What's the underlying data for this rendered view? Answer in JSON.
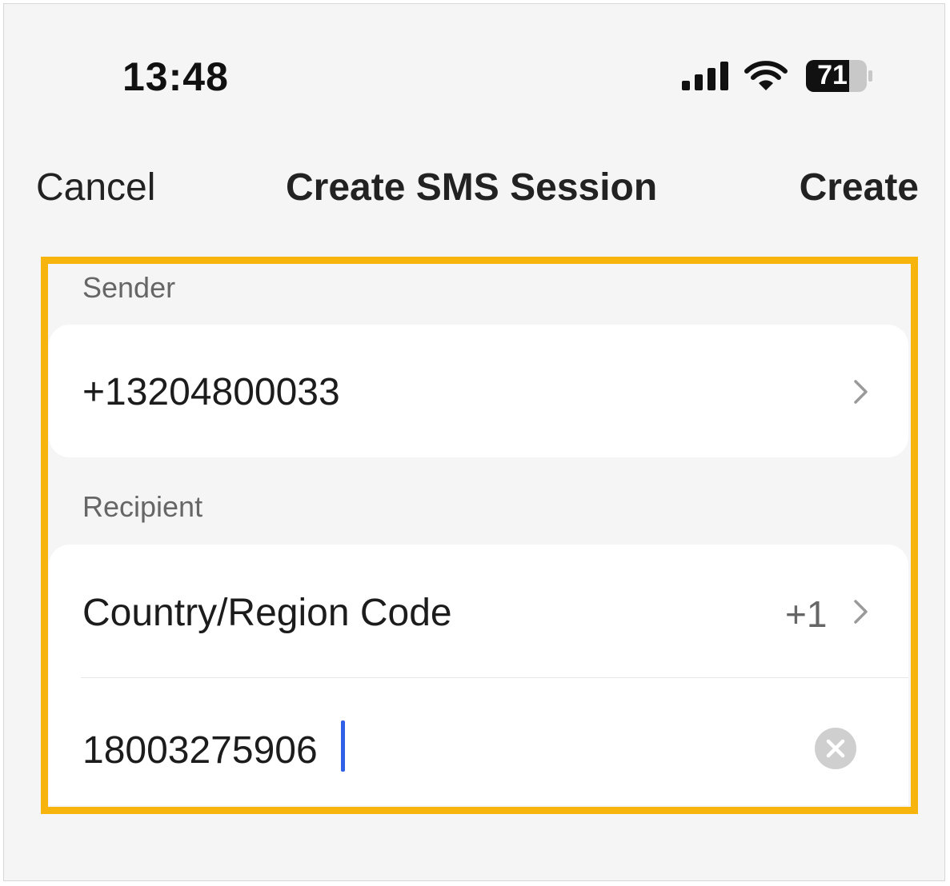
{
  "status_bar": {
    "time": "13:48",
    "battery_level": "71",
    "icons": [
      "signal-icon",
      "wifi-icon",
      "battery-icon"
    ]
  },
  "nav": {
    "cancel_label": "Cancel",
    "title": "Create SMS Session",
    "create_label": "Create"
  },
  "sender": {
    "section_label": "Sender",
    "number": "+13204800033"
  },
  "recipient": {
    "section_label": "Recipient",
    "country_label": "Country/Region Code",
    "country_value": "+1",
    "phone_value": "18003275906"
  },
  "colors": {
    "highlight": "#f7b40c",
    "caret": "#3060e8",
    "background": "#f5f5f5"
  }
}
